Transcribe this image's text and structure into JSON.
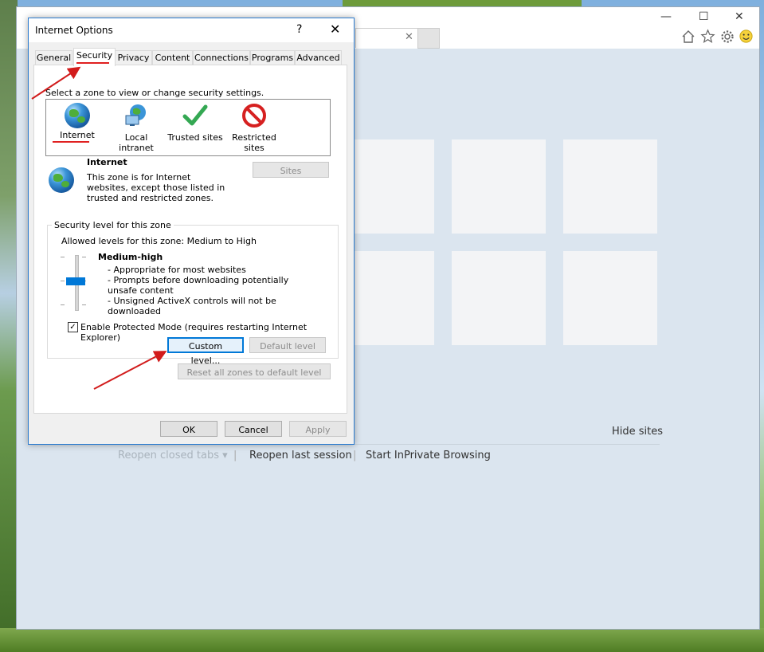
{
  "browser": {
    "window_controls": {
      "minimize": "—",
      "maximize": "☐",
      "close": "✕"
    },
    "tab_close": "✕",
    "toolbar_icons": [
      "home-icon",
      "star-icon",
      "gear-icon",
      "smiley-icon"
    ],
    "hide_sites": "Hide sites",
    "bottom_links": {
      "reopen_closed": "Reopen closed tabs ▾",
      "reopen_last": "Reopen last session",
      "inprivate": "Start InPrivate Browsing",
      "separator": "|"
    }
  },
  "dialog": {
    "title": "Internet Options",
    "help": "?",
    "close": "✕",
    "tabs": [
      "General",
      "Security",
      "Privacy",
      "Content",
      "Connections",
      "Programs",
      "Advanced"
    ],
    "active_tab": "Security",
    "zone_prompt": "Select a zone to view or change security settings.",
    "zones": [
      {
        "label": "Internet",
        "icon": "globe-icon"
      },
      {
        "label": "Local intranet",
        "icon": "intranet-icon"
      },
      {
        "label": "Trusted sites",
        "icon": "checkmark-icon"
      },
      {
        "label": "Restricted sites",
        "icon": "restricted-icon"
      }
    ],
    "zone_info": {
      "name": "Internet",
      "description": "This zone is for Internet websites, except those listed in trusted and restricted zones."
    },
    "sites_button": "Sites",
    "security_group": {
      "label": "Security level for this zone",
      "allowed": "Allowed levels for this zone: Medium to High",
      "level_title": "Medium-high",
      "level_points": [
        "- Appropriate for most websites",
        "- Prompts before downloading potentially unsafe content",
        "- Unsigned ActiveX controls will not be downloaded"
      ],
      "protected_mode_checked": true,
      "protected_mode_label": "Enable Protected Mode (requires restarting Internet Explorer)",
      "custom_level": "Custom level...",
      "default_level": "Default level"
    },
    "reset_all": "Reset all zones to default level",
    "buttons": {
      "ok": "OK",
      "cancel": "Cancel",
      "apply": "Apply"
    }
  },
  "colors": {
    "accent": "#0078d7",
    "annotation": "#d21c1c",
    "dialog_border": "#2b7bcf"
  }
}
